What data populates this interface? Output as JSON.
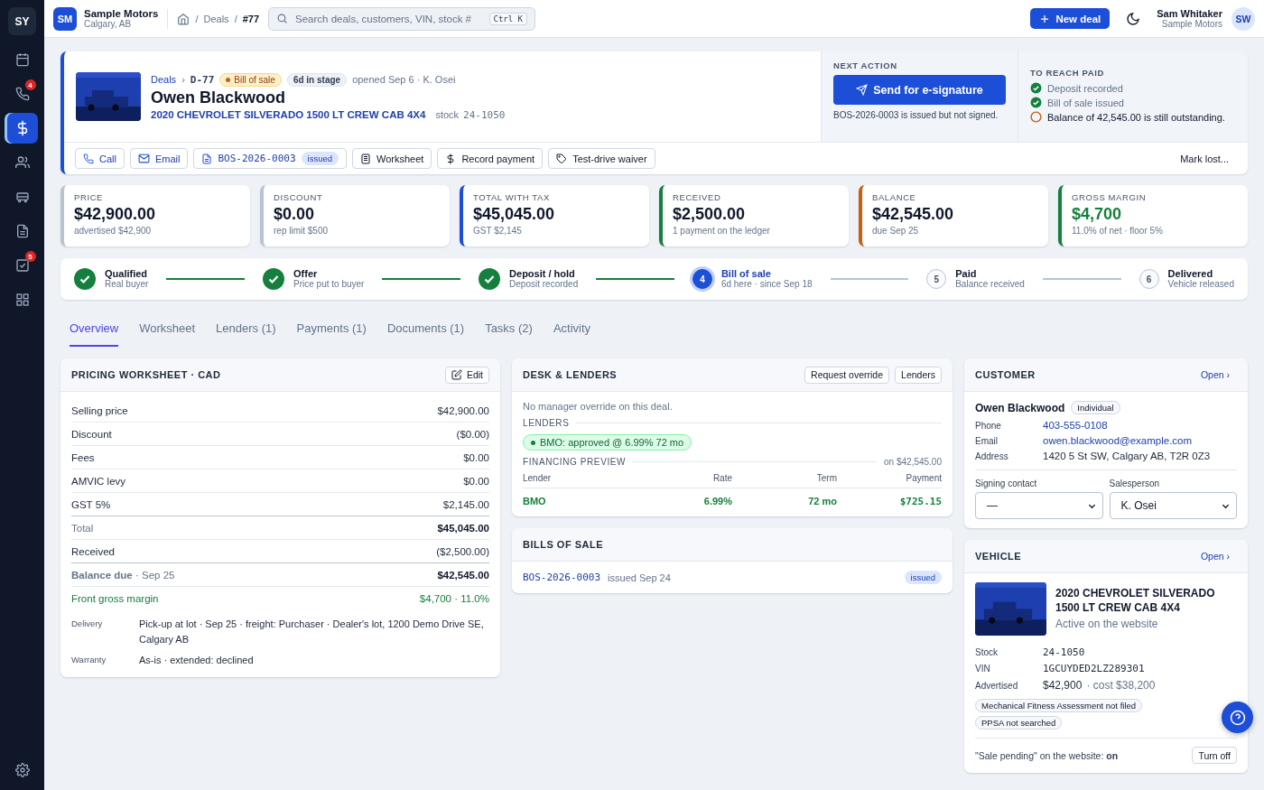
{
  "sidebar": {
    "logo": "SY",
    "items": [
      {
        "kind": "calendar",
        "selected": false
      },
      {
        "kind": "phone",
        "badge": "4",
        "selected": false
      },
      {
        "kind": "dollar",
        "selected": true
      },
      {
        "kind": "people",
        "selected": false
      },
      {
        "kind": "car",
        "selected": false
      },
      {
        "kind": "document",
        "selected": false
      },
      {
        "kind": "tasks",
        "badge": "5",
        "selected": false
      },
      {
        "kind": "grid",
        "selected": false
      }
    ]
  },
  "topbar": {
    "brand": {
      "initials": "SM",
      "name": "Sample Motors",
      "city": "Calgary, AB"
    },
    "breadcrumb": [
      {
        "sep": "/",
        "label": "Deals"
      },
      {
        "sep": "/",
        "label": "#77"
      }
    ],
    "search": {
      "placeholder": "Search deals, customers, VIN, stock #",
      "shortcut": "Ctrl K"
    },
    "new_deal": "New deal",
    "user": {
      "name": "Sam Whitaker",
      "org": "Sample Motors",
      "initials": "SW"
    }
  },
  "deal": {
    "crumb": "Deals",
    "sep": "›",
    "id": "D-77",
    "stage": "Bill of sale",
    "days": "6d in stage",
    "opened": "opened Sep 6 · K. Osei",
    "customer": "Owen Blackwood",
    "vehicle": "2020 CHEVROLET SILVERADO 1500 LT CREW CAB 4X4",
    "stock_label": "stock",
    "stock": "24-1050",
    "actions": [
      {
        "kind": "phone",
        "label": "Call"
      },
      {
        "kind": "mail",
        "label": "Email"
      },
      {
        "kind": "document",
        "label": "BOS-2026-0003",
        "tag": "issued"
      },
      {
        "kind": "sheet",
        "label": "Worksheet"
      },
      {
        "kind": "dollar",
        "label": "Record payment"
      },
      {
        "kind": "tag",
        "label": "Test-drive waiver"
      }
    ],
    "mark_lost": "Mark lost...",
    "next_action": {
      "title": "NEXT ACTION",
      "button": "Send for e-signature",
      "note": "BOS-2026-0003 is issued but not signed."
    },
    "reach_paid": {
      "title": "TO REACH PAID",
      "items": [
        {
          "label": "Deposit recorded",
          "done": true
        },
        {
          "label": "Bill of sale issued",
          "done": true
        },
        {
          "label": "Balance of 42,545.00 is still outstanding.",
          "done": false
        }
      ]
    }
  },
  "kpis": [
    {
      "label": "PRICE",
      "value": "$42,900.00",
      "sub": "advertised $42,900",
      "color": "#b9c3d2",
      "highlight": false
    },
    {
      "label": "DISCOUNT",
      "value": "$0.00",
      "sub": "rep limit $500",
      "color": "#b9c3d2",
      "highlight": false
    },
    {
      "label": "TOTAL WITH TAX",
      "value": "$45,045.00",
      "sub": "GST $2,145",
      "color": "#1d4ed8",
      "highlight": false
    },
    {
      "label": "RECEIVED",
      "value": "$2,500.00",
      "sub": "1 payment on the ledger",
      "color": "#15803d",
      "highlight": false
    },
    {
      "label": "BALANCE",
      "value": "$42,545.00",
      "sub": "due Sep 25",
      "color": "#c2620f",
      "highlight": false
    },
    {
      "label": "GROSS MARGIN",
      "value": "$4,700",
      "sub": "11.0% of net · floor 5%",
      "color": "#15803d",
      "highlight": true
    }
  ],
  "steps": [
    {
      "label": "Qualified",
      "sub": "Real buyer",
      "done": true,
      "current": false
    },
    {
      "label": "Offer",
      "sub": "Price put to buyer",
      "done": true,
      "current": false
    },
    {
      "label": "Deposit / hold",
      "sub": "Deposit recorded",
      "done": true,
      "current": false
    },
    {
      "label": "Bill of sale",
      "sub": "6d here · since Sep 18",
      "done": false,
      "current": true,
      "number": "4"
    },
    {
      "label": "Paid",
      "sub": "Balance received",
      "done": false,
      "current": false,
      "number": "5"
    },
    {
      "label": "Delivered",
      "sub": "Vehicle released",
      "done": false,
      "current": false,
      "number": "6"
    }
  ],
  "tabs": [
    {
      "label": "Overview",
      "selected": true
    },
    {
      "label": "Worksheet",
      "selected": false
    },
    {
      "label": "Lenders (1)",
      "selected": false
    },
    {
      "label": "Payments (1)",
      "selected": false
    },
    {
      "label": "Documents (1)",
      "selected": false
    },
    {
      "label": "Tasks (2)",
      "selected": false
    },
    {
      "label": "Activity",
      "selected": false
    }
  ],
  "pricing": {
    "title": "PRICING WORKSHEET · CAD",
    "edit": "Edit",
    "rows": [
      {
        "label": "Selling price",
        "value": "$42,900.00",
        "kind": "line"
      },
      {
        "label": "Discount",
        "value": "($0.00)",
        "kind": "line"
      },
      {
        "label": "Fees",
        "value": "$0.00",
        "kind": "line"
      },
      {
        "label": "AMVIC levy",
        "value": "$0.00",
        "kind": "line"
      },
      {
        "label": "GST 5%",
        "value": "$2,145.00",
        "kind": "line"
      },
      {
        "label": "Total",
        "value": "$45,045.00",
        "kind": "total"
      },
      {
        "label": "Received",
        "value": "($2,500.00)",
        "kind": "line"
      },
      {
        "label": "**Balance due** · Sep 25",
        "value": "$42,545.00",
        "kind": "total"
      },
      {
        "label": "Front gross margin",
        "value": "$4,700 · 11.0%",
        "kind": "margin"
      }
    ],
    "details": [
      {
        "label": "Delivery",
        "value": "Pick-up at lot · Sep 25 · freight: Purchaser · Dealer's lot, 1200 Demo Drive SE, Calgary AB"
      },
      {
        "label": "Warranty",
        "value": "As-is · extended: declined"
      }
    ]
  },
  "desk": {
    "title": "DESK & LENDERS",
    "buttons": [
      "Request override",
      "Lenders"
    ],
    "note": "No manager override on this deal.",
    "lenders_title": "LENDERS",
    "lender_chip": "BMO: approved @ 6.99% 72 mo",
    "preview_title": "FINANCING PREVIEW",
    "preview_on": "on $42,545.00",
    "columns": [
      "Lender",
      "Rate",
      "Term",
      "Payment"
    ],
    "rows": [
      [
        "BMO",
        "6.99%",
        "72 mo",
        "$725.15"
      ]
    ]
  },
  "bills": {
    "title": "BILLS OF SALE",
    "items": [
      {
        "id": "BOS-2026-0003",
        "issued": "issued Sep 24",
        "status": "issued"
      }
    ]
  },
  "customer": {
    "title": "CUSTOMER",
    "open": "Open ›",
    "name": "Owen Blackwood",
    "type": "Individual",
    "fields": [
      {
        "label": "Phone",
        "value": "403-555-0108",
        "link": true
      },
      {
        "label": "Email",
        "value": "owen.blackwood@example.com",
        "link": true
      },
      {
        "label": "Address",
        "value": "1420 5 St SW, Calgary AB, T2R 0Z3",
        "link": false
      }
    ],
    "selects": [
      {
        "label": "Signing contact",
        "value": "—"
      },
      {
        "label": "Salesperson",
        "value": "K. Osei"
      }
    ]
  },
  "vehicle": {
    "title": "VEHICLE",
    "open": "Open ›",
    "name": "2020 CHEVROLET SILVERADO 1500 LT CREW CAB 4X4",
    "status": "Active on the website",
    "fields": [
      {
        "label": "Stock",
        "value": "24-1050",
        "mono": true
      },
      {
        "label": "VIN",
        "value": "1GCUYDED2LZ289301",
        "mono": true
      },
      {
        "label": "Advertised",
        "value": "$42,900",
        "note": "· cost $38,200",
        "mono": false
      }
    ],
    "flags": [
      "Mechanical Fitness Assessment not filed",
      "PPSA not searched"
    ],
    "pending": "\"Sale pending\" on the website: **on**",
    "turn_off": "Turn off"
  }
}
